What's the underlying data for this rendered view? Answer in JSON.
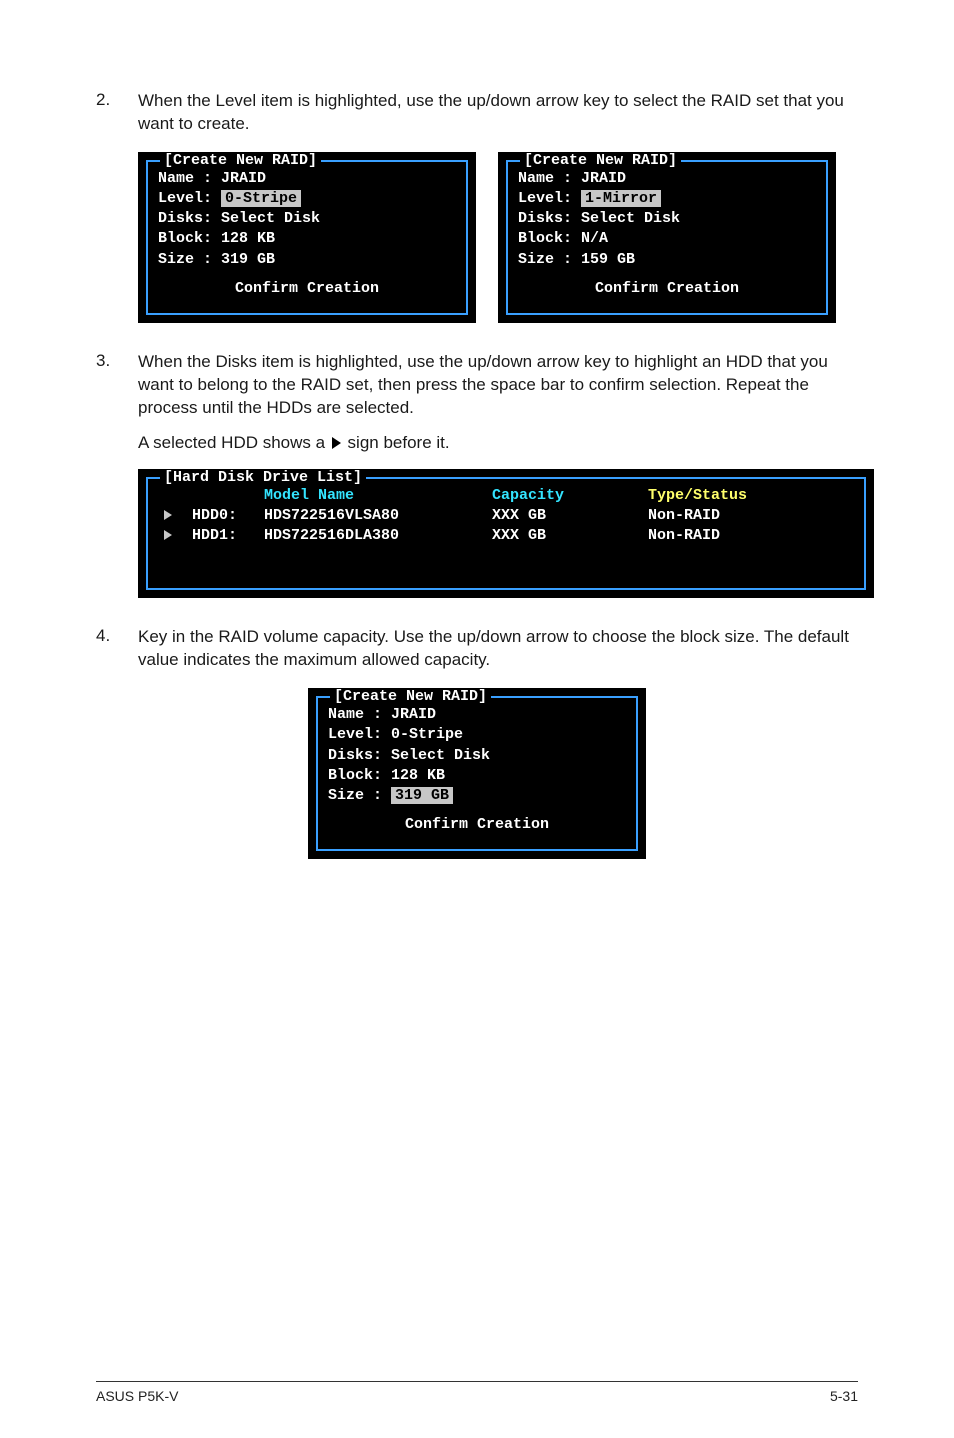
{
  "steps": {
    "s2": {
      "num": "2.",
      "text": "When the Level item is highlighted, use the up/down arrow key to select the RAID set that you want to create."
    },
    "s3": {
      "num": "3.",
      "text": "When the Disks item is highlighted, use the up/down arrow key to highlight an HDD that you want to belong to the RAID set, then press the space bar to confirm selection. Repeat the process until the HDDs are selected."
    },
    "s3b_before": "A selected HDD shows a ",
    "s3b_after": " sign before it.",
    "s4": {
      "num": "4.",
      "text": "Key in the RAID volume capacity. Use the up/down arrow to choose the block size. The default value indicates the maximum allowed capacity."
    }
  },
  "panel_left": {
    "title": "Create New RAID",
    "name": "Name : JRAID",
    "level_lbl": "Level:",
    "level_val": "0-Stripe",
    "disks": "Disks: Select Disk",
    "block": "Block: 128 KB",
    "size": "Size : 319 GB",
    "confirm": "Confirm Creation"
  },
  "panel_right": {
    "title": "Create New RAID",
    "name": "Name : JRAID",
    "level_lbl": "Level:",
    "level_val": "1-Mirror",
    "disks": "Disks: Select Disk",
    "block": "Block: N/A",
    "size": "Size : 159 GB",
    "confirm": "Confirm Creation"
  },
  "disk_list": {
    "title": "Hard Disk Drive List",
    "head": {
      "model": "Model Name",
      "cap": "Capacity",
      "type": "Type/Status"
    },
    "rows": [
      {
        "id": "HDD0:",
        "model": "HDS722516VLSA80",
        "cap": "XXX GB",
        "type": "Non-RAID"
      },
      {
        "id": "HDD1:",
        "model": "HDS722516DLA380",
        "cap": "XXX GB",
        "type": "Non-RAID"
      }
    ]
  },
  "panel_size": {
    "title": "Create New RAID",
    "name": "Name : JRAID",
    "level": "Level: 0-Stripe",
    "disks": "Disks: Select Disk",
    "block": "Block: 128 KB",
    "size_lbl": "Size :",
    "size_val": "319 GB",
    "confirm": "Confirm Creation"
  },
  "footer": {
    "left": "ASUS P5K-V",
    "right": "5-31"
  }
}
